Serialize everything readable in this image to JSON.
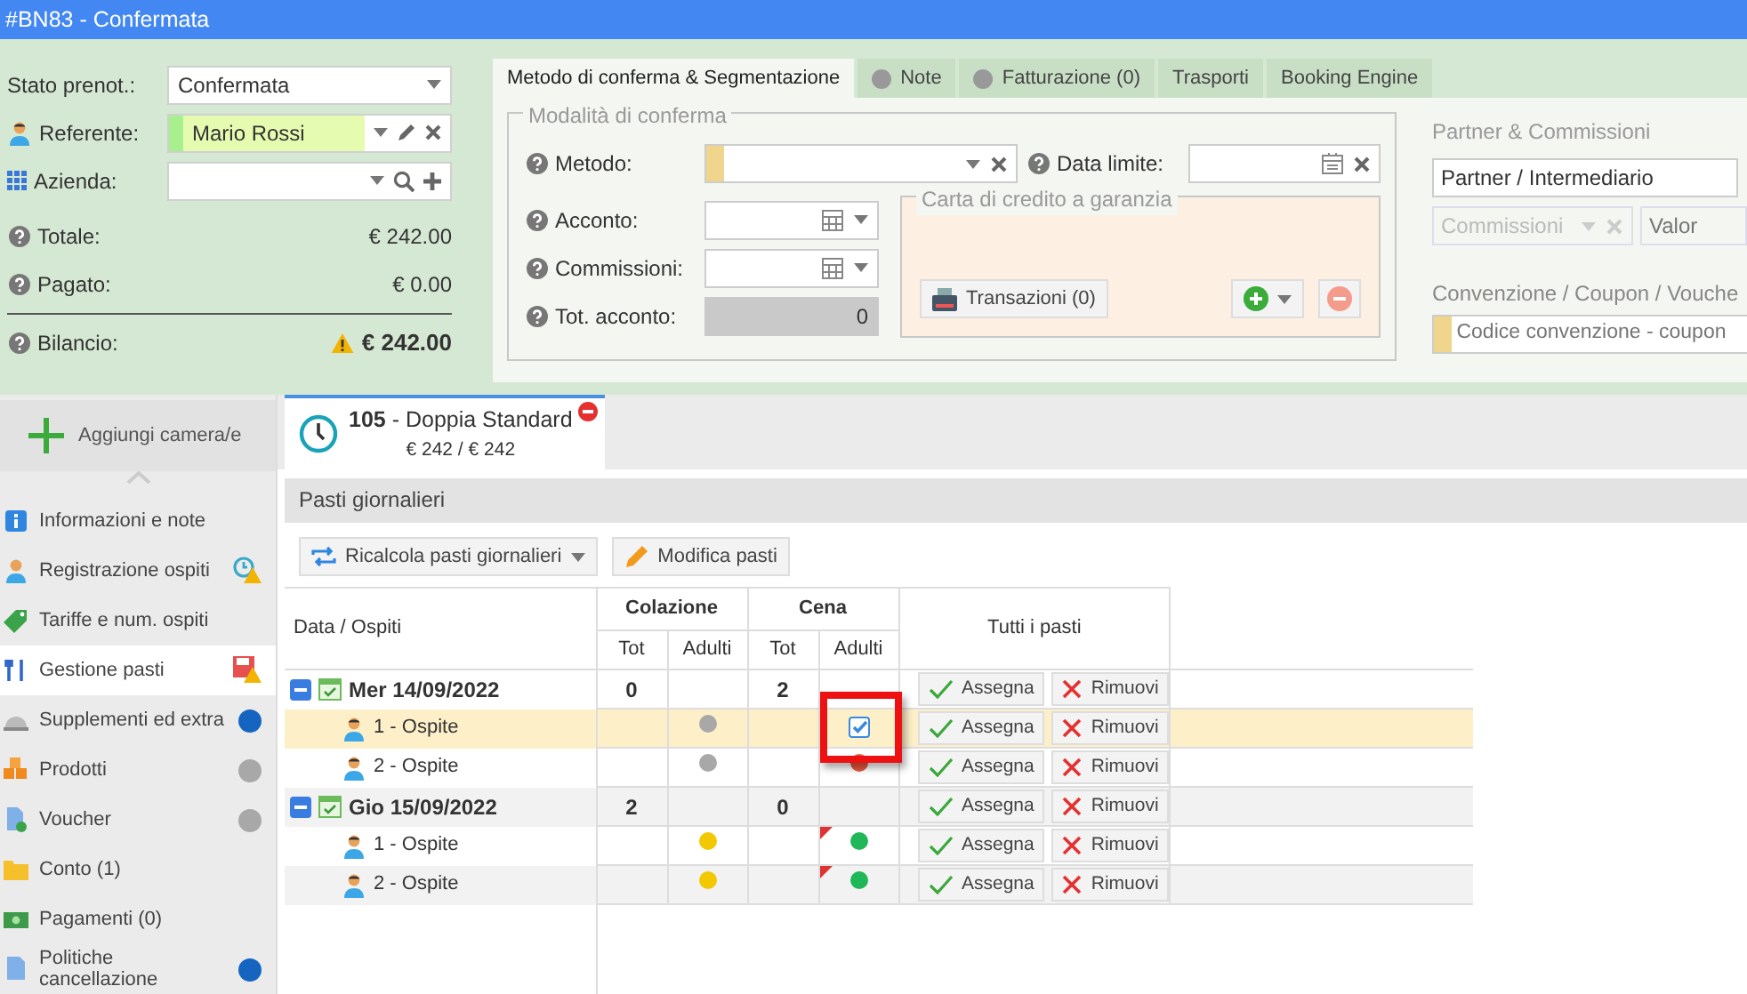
{
  "window": {
    "title": "#BN83 - Confermata"
  },
  "booking": {
    "status": {
      "label": "Stato prenot.:",
      "value": "Confermata"
    },
    "referent": {
      "label": "Referente:",
      "value": "Mario Rossi"
    },
    "company": {
      "label": "Azienda:"
    },
    "totals": [
      {
        "label": "Totale:",
        "value": "€ 242.00",
        "warning": false
      },
      {
        "label": "Pagato:",
        "value": "€ 0.00",
        "warning": false
      },
      {
        "label": "Bilancio:",
        "value": "€ 242.00",
        "warning": true
      }
    ]
  },
  "tabs": [
    {
      "label": "Metodo di conferma & Segmentazione",
      "selected": true,
      "dot": false
    },
    {
      "label": "Note",
      "selected": false,
      "dot": true
    },
    {
      "label": "Fatturazione (0)",
      "selected": false,
      "dot": true
    },
    {
      "label": "Trasporti",
      "selected": false,
      "dot": false
    },
    {
      "label": "Booking Engine",
      "selected": false,
      "dot": false
    }
  ],
  "confirmation": {
    "legend": "Modalità di conferma",
    "method_label": "Metodo:",
    "deadline_label": "Data limite:",
    "deposit_label": "Acconto:",
    "commission_label": "Commissioni:",
    "total_deposit_label": "Tot. acconto:",
    "total_deposit_value": "0",
    "card": {
      "legend": "Carta di credito a garanzia",
      "transactions_button": "Transazioni (0)"
    }
  },
  "partner": {
    "title": "Partner & Commissioni",
    "partner_select": "Partner / Intermediario",
    "commission_select": "Commissioni",
    "value_placeholder": "Valor",
    "coupon_title": "Convenzione / Coupon / Vouche",
    "coupon_placeholder": "Codice convenzione - coupon"
  },
  "sidebar": {
    "add_button": "Aggiungi camera/e",
    "items": [
      {
        "label": "Informazioni e note",
        "selected": false,
        "warning": false
      },
      {
        "label": "Registrazione ospiti",
        "selected": false,
        "warning": true
      },
      {
        "label": "Tariffe e num. ospiti",
        "selected": false,
        "warning": false
      },
      {
        "label": "Gestione pasti",
        "selected": true,
        "warning": true
      },
      {
        "label": "Supplementi ed extra",
        "selected": false,
        "warning": false,
        "color": "#1565c0"
      },
      {
        "label": "Prodotti",
        "selected": false,
        "warning": false,
        "color": "#a8a8a8"
      },
      {
        "label": "Voucher",
        "selected": false,
        "warning": false,
        "color": "#a8a8a8"
      },
      {
        "label": "Conto (1)",
        "selected": false,
        "warning": false
      },
      {
        "label": "Pagamenti (0)",
        "selected": false,
        "warning": false
      },
      {
        "label": "Politiche cancellazione",
        "selected": false,
        "warning": false,
        "color": "#1565c0"
      }
    ]
  },
  "room_tab": {
    "title": "**105** - Doppia Standard",
    "price": "€ 242 / € 242"
  },
  "meals": {
    "title": "Pasti giornalieri",
    "toolbar": [
      {
        "label": "Ricalcola pasti giornalieri",
        "dropdown": true
      },
      {
        "label": "Modifica pasti",
        "dropdown": false
      }
    ],
    "table": {
      "first_column": "Data / Ospiti",
      "groups": [
        {
          "label": "Colazione",
          "columns": [
            "Tot",
            "Adulti"
          ]
        },
        {
          "label": "Cena",
          "columns": [
            "Tot",
            "Adulti"
          ]
        }
      ],
      "all_column": "Tutti i pasti",
      "rows": [
        {
          "kind": "date",
          "label": "Mer 14/09/2022",
          "expanded": true,
          "totals": [
            "0",
            "2"
          ],
          "assign": "Assegna",
          "remove": "Rimuovi"
        },
        {
          "kind": "guest",
          "label": "1 - Ospite",
          "selected": true,
          "meals": [
            {
              "kind": "dot",
              "color": "#a8a8a8",
              "flag": false,
              "highlighted": false
            },
            {
              "kind": "checkbox",
              "checked": true,
              "flag": false,
              "highlighted": true
            }
          ],
          "assign": "Assegna",
          "remove": "Rimuovi"
        },
        {
          "kind": "guest",
          "label": "2 - Ospite",
          "selected": false,
          "meals": [
            {
              "kind": "dot",
              "color": "#a8a8a8",
              "flag": false,
              "highlighted": false
            },
            {
              "kind": "dot",
              "color": "#e8573c",
              "flag": false,
              "highlighted": false
            }
          ],
          "assign": "Assegna",
          "remove": "Rimuovi"
        },
        {
          "kind": "date",
          "label": "Gio 15/09/2022",
          "expanded": true,
          "totals": [
            "2",
            "0"
          ],
          "assign": "Assegna",
          "remove": "Rimuovi"
        },
        {
          "kind": "guest",
          "label": "1 - Ospite",
          "selected": false,
          "meals": [
            {
              "kind": "dot",
              "color": "#f2c800",
              "flag": false,
              "highlighted": false
            },
            {
              "kind": "dot",
              "color": "#1fb757",
              "flag": true,
              "highlighted": false
            }
          ],
          "assign": "Assegna",
          "remove": "Rimuovi"
        },
        {
          "kind": "guest",
          "label": "2 - Ospite",
          "selected": false,
          "meals": [
            {
              "kind": "dot",
              "color": "#f2c800",
              "flag": false,
              "highlighted": false
            },
            {
              "kind": "dot",
              "color": "#1fb757",
              "flag": true,
              "highlighted": false
            }
          ],
          "assign": "Assegna",
          "remove": "Rimuovi"
        }
      ]
    }
  }
}
